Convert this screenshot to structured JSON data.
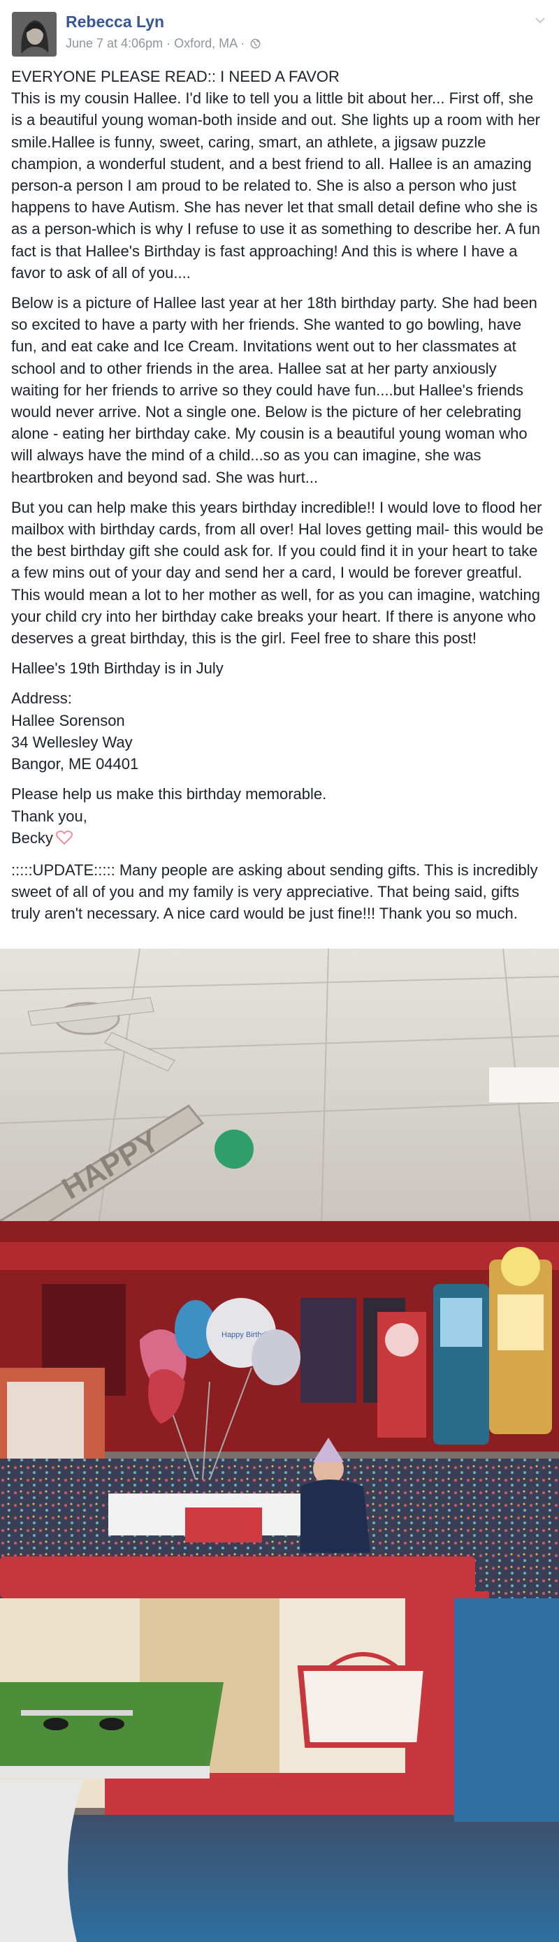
{
  "post": {
    "author": "Rebecca Lyn",
    "date": "June 7 at 4:06pm",
    "separator": "·",
    "location": "Oxford, MA",
    "separator2": "·",
    "privacy_icon": "globe-icon",
    "menu_icon": "chevron-down-icon",
    "title": "EVERYONE PLEASE READ:: I NEED A FAVOR",
    "p1": "This is my cousin Hallee. I'd like to tell you a little bit about her... First off, she is a beautiful young woman-both inside and out. She lights up a room with her smile.Hallee is funny, sweet, caring, smart, an athlete, a jigsaw puzzle champion, a wonderful student, and a best friend to all. Hallee is an amazing person-a person I am proud to be related to. She is also a person who just happens to have Autism. She has never let that small detail define who she is as a person-which is why I refuse to use it as something to describe her. A fun fact is that Hallee's Birthday is fast approaching! And this is where I have a favor to ask of all of you....",
    "p2": "Below is a picture of Hallee last year at her 18th birthday party. She had been so excited to have a party with her friends. She wanted to go bowling, have fun, and eat cake and Ice Cream. Invitations went out to her classmates at school and to other friends in the area. Hallee sat at her party anxiously waiting for her friends to arrive so they could have fun....but Hallee's friends would never arrive. Not a single one. Below is the picture of her celebrating alone - eating her birthday cake. My cousin is a beautiful young woman who will always have the mind of a child...so as you can imagine, she was heartbroken and beyond sad. She was hurt...",
    "p3": "But you can help make this years birthday incredible!! I would love to flood her mailbox with birthday cards, from all over! Hal loves getting mail- this would be the best birthday gift she could ask for. If you could find it in your heart to take a few mins out of your day and send her a card, I would be forever greatful. This would mean a lot to her mother as well, for as you can imagine, watching your child cry into her birthday cake breaks your heart. If there is anyone who deserves a great birthday, this is the girl. Feel free to share this post!",
    "p4": "Hallee's 19th Birthday is in July",
    "address_label": "Address:",
    "address_name": "Hallee Sorenson",
    "address_street": "34 Wellesley Way",
    "address_city": "Bangor, ME 04401",
    "closing1": "Please help us make this birthday memorable.",
    "closing2": "Thank you,",
    "signature": "Becky",
    "signature_icon": "heart-icon",
    "update": ":::::UPDATE::::: Many people are asking about sending gifts. This is incredibly sweet of all of you and my family is very appreciative. That being said, gifts truly aren't necessary. A nice card would be just fine!!! Thank you so much.",
    "banner_text": "HAPPY",
    "balloon_text": "Happy Birthday"
  }
}
